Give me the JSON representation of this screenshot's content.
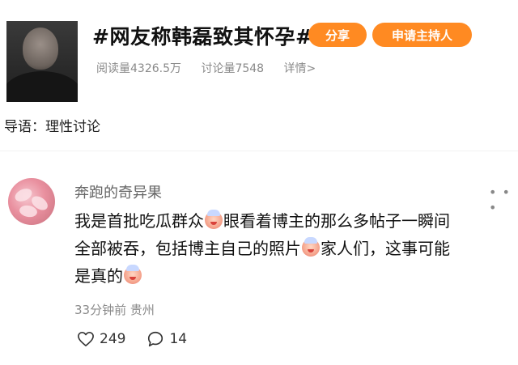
{
  "topic": {
    "title": "#网友称韩磊致其怀孕#",
    "share_label": "分享",
    "apply_host_label": "申请主持人",
    "reads": "阅读量4326.5万",
    "discussions": "讨论量7548",
    "details": "详情>"
  },
  "guide": "导语：理性讨论",
  "comment": {
    "author": "奔跑的奇异果",
    "text_line1": "我是首批吃瓜群众",
    "text_line1b": "眼看着博主的那么多帖子一瞬间",
    "text_line2": "全部被吞，包括博主自己的照片",
    "text_line2b": "家人们，这事可能",
    "text_line3": "是真的",
    "time": "33分钟前",
    "location": "贵州",
    "likes": "249",
    "replies": "14"
  },
  "icons": {
    "more": "more-icon",
    "like": "heart-icon",
    "reply": "comment-icon",
    "emoji": "clown-emoji-icon"
  },
  "colors": {
    "accent": "#ff8a22",
    "muted": "#8a8a8a"
  }
}
